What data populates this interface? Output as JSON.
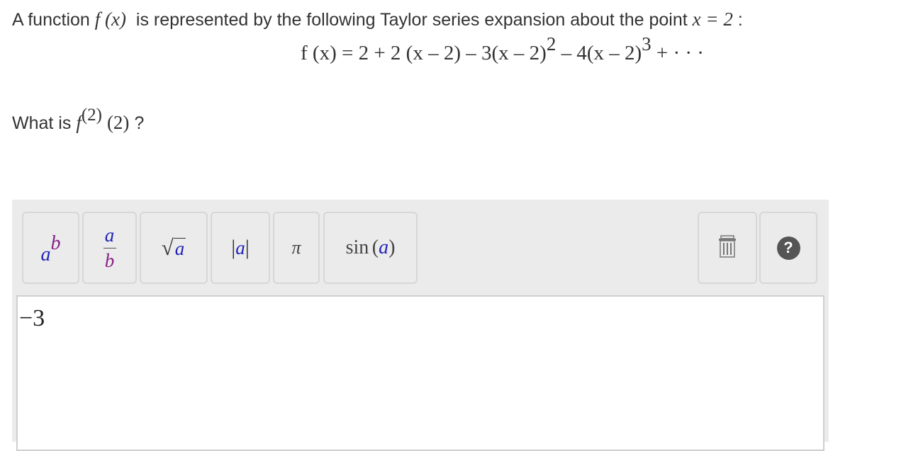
{
  "question": {
    "intro": "A function",
    "function_expr": "f (x)",
    "middle": "is represented by the following Taylor series expansion about the point",
    "point_expr": "x = 2",
    "colon": ":"
  },
  "series": {
    "lhs": "f (x) = 2 + 2 (x – 2) – 3(x – 2)",
    "exp1": "2",
    "mid": " – 4(x – 2)",
    "exp2": "3",
    "tail": " + · · ·"
  },
  "ask": {
    "prefix": "What is",
    "f": "f",
    "order": "(2)",
    "arg": "(2)",
    "qmark": "?"
  },
  "toolbar": {
    "power": {
      "base": "a",
      "exp": "b"
    },
    "fraction": {
      "num": "a",
      "den": "b"
    },
    "sqrt": {
      "symbol": "√",
      "arg": "a"
    },
    "abs": {
      "left": "|",
      "arg": "a",
      "right": "|"
    },
    "pi": "π",
    "sin": {
      "fn": "sin",
      "open": "(",
      "arg": "a",
      "close": ")"
    },
    "delete_icon": "trash-icon",
    "help_icon": "question-icon",
    "help_glyph": "?"
  },
  "answer": {
    "value": "−3"
  },
  "colors": {
    "variable_blue": "#2222bb",
    "variable_purple": "#882288",
    "toolbar_bg": "#ebebeb"
  }
}
